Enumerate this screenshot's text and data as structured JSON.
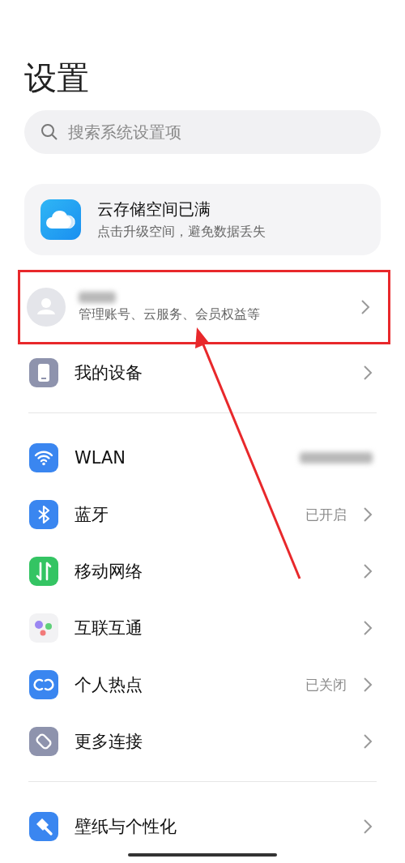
{
  "title": "设置",
  "search": {
    "placeholder": "搜索系统设置项"
  },
  "cloud_card": {
    "title": "云存储空间已满",
    "subtitle": "点击升级空间，避免数据丢失"
  },
  "account": {
    "subtitle": "管理账号、云服务、会员权益等",
    "highlighted": true
  },
  "groups": [
    {
      "items": [
        {
          "kind": "device",
          "label": "我的设备"
        }
      ]
    },
    {
      "items": [
        {
          "kind": "wifi",
          "label": "WLAN",
          "value_redacted": true
        },
        {
          "kind": "bluetooth",
          "label": "蓝牙",
          "value": "已开启"
        },
        {
          "kind": "mobile",
          "label": "移动网络"
        },
        {
          "kind": "dots",
          "label": "互联互通"
        },
        {
          "kind": "hotspot",
          "label": "个人热点",
          "value": "已关闭"
        },
        {
          "kind": "link",
          "label": "更多连接"
        }
      ]
    },
    {
      "items": [
        {
          "kind": "brush",
          "label": "壁纸与个性化"
        }
      ]
    }
  ]
}
